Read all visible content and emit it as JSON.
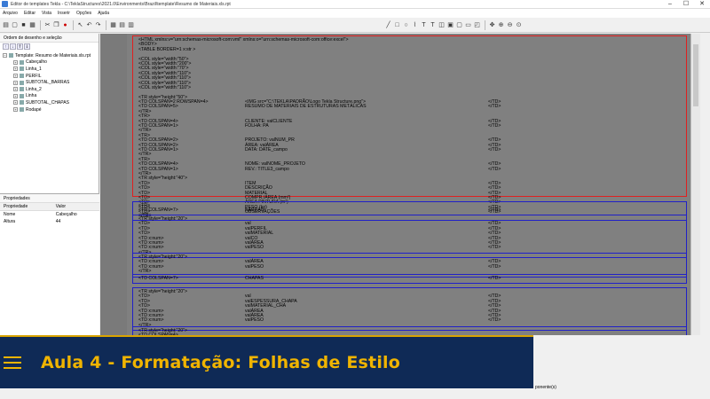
{
  "window": {
    "title": "Editor de templates Tekla - C:\\TeklaStructures\\2021.0\\Environments\\Brazil\\template\\Resumo de Materiais.xls.rpt",
    "minimize": "–",
    "maximize": "☐",
    "close": "✕"
  },
  "menu": [
    "Arquivo",
    "Editar",
    "Vista",
    "Inserir",
    "Opções",
    "Ajuda"
  ],
  "tree_panel": {
    "caption": "Ordem de desenho e seleção",
    "root": "Template: Resumo de Materiais.xls.rpt",
    "items": [
      "Cabeçalho",
      "Linha_1",
      "PERFIL",
      "SUBTOTAL_BARRAS",
      "Linha_2",
      "Linha",
      "SUBTOTAL_CHAPAS",
      "Rodapé"
    ]
  },
  "properties": {
    "caption": "Propriedades",
    "col_property": "Propriedade",
    "col_value": "Valor",
    "rows": [
      {
        "name": "Nome",
        "value": "Cabeçalho"
      },
      {
        "name": "Altura",
        "value": "44"
      }
    ]
  },
  "banner": {
    "title": "Aula 4 - Formatação: Folhas de Estilo"
  },
  "status": {
    "text": "ponente(s)"
  },
  "colors": {
    "header_border": "#e02020",
    "section_border": "#2020c8",
    "banner_bg": "#0f2a56",
    "banner_accent": "#f0b400"
  },
  "sections": [
    {
      "name": "header-section",
      "kind": "red",
      "lines": [
        [
          "<HTML xmlns:v=\"urn:schemas-microsoft-com:vml\" xmlns:o=\"urn:schemas-microsoft-com:office:excel\">",
          "",
          ""
        ],
        [
          "    <BODY>",
          "",
          ""
        ],
        [
          "    <TABLE BORDER=1 x:str >",
          "",
          ""
        ],
        [
          "",
          "",
          ""
        ],
        [
          "        <COL style=\"width:\"50\">",
          "",
          ""
        ],
        [
          "        <COL style=\"width:\"200\">",
          "",
          ""
        ],
        [
          "        <COL style=\"width:\"70\">",
          "",
          ""
        ],
        [
          "        <COL style=\"width:\"110\">",
          "",
          ""
        ],
        [
          "        <COL style=\"width:\"110\">",
          "",
          ""
        ],
        [
          "        <COL style=\"width:\"110\">",
          "",
          ""
        ],
        [
          "        <COL style=\"width:\"110\">",
          "",
          ""
        ],
        [
          "",
          "",
          ""
        ],
        [
          "        <TR style=\"height:\"50\">",
          "",
          ""
        ],
        [
          "            <TD COLSPAN=2 ROWSPAN=4>",
          "<IMG src=\"C:\\TEKLA\\PADRÃO\\Logo Tekla Structure.png\">",
          "</TD>"
        ],
        [
          "            <TD COLSPAN=5>",
          "RESUMO DE MATERIAIS DE ESTRUTURAS METÁLICAS",
          "</TD>"
        ],
        [
          "        </TR>",
          "",
          ""
        ],
        [
          "        <TR>",
          "",
          ""
        ],
        [
          "            <TD COLSPAN=4>",
          "CLIENTE: valCLIENTE",
          "</TD>"
        ],
        [
          "            <TD COLSPAN=1>",
          "FOLHA: PA",
          "</TD>"
        ],
        [
          "        </TR>",
          "",
          ""
        ],
        [
          "        <TR>",
          "",
          ""
        ],
        [
          "            <TD COLSPAN=2>",
          "PROJETO: valNUM_PR",
          "</TD>"
        ],
        [
          "            <TD COLSPAN=2>",
          "ÁREA: valÁREA",
          "</TD>"
        ],
        [
          "            <TD COLSPAN=1>",
          "DATA: DATE_campo",
          "</TD>"
        ],
        [
          "        </TR>",
          "",
          ""
        ],
        [
          "        <TR>",
          "",
          ""
        ],
        [
          "            <TD COLSPAN=4>",
          "NOME: valNOME_PROJETO",
          "</TD>"
        ],
        [
          "            <TD COLSPAN=1>",
          "REV.: TITLE3_campo",
          "</TD>"
        ],
        [
          "        </TR>",
          "",
          ""
        ],
        [
          "        <TR style=\"height:\"40\">",
          "",
          ""
        ],
        [
          "            <TD>",
          "ITEM",
          "</TD>"
        ],
        [
          "            <TD>",
          "DESCRIÇÃO",
          "</TD>"
        ],
        [
          "            <TD>",
          "MATERIAL",
          "</TD>"
        ],
        [
          "            <TD>",
          "COMPR./ÁREA   (mm²)",
          "</TD>"
        ],
        [
          "            <TD>",
          "ÁREA PINTURA   (m²)",
          "</TD>"
        ],
        [
          "            <TD>",
          "PESO  (kg)",
          "</TD>"
        ],
        [
          "            <TD>",
          "OBSERVAÇÕES",
          "</TD>"
        ],
        [
          "        </TR>",
          "",
          ""
        ]
      ]
    },
    {
      "name": "linha-1-section",
      "kind": "blue",
      "lines": [
        [
          "        <TR>",
          "",
          ""
        ],
        [
          "            <TD COLSPAN=7>",
          "BARRAS",
          "</TD>"
        ],
        [
          "        </TR>",
          "",
          ""
        ]
      ]
    },
    {
      "name": "perfil-section",
      "kind": "blue",
      "lines": [
        [
          "        <TR style=\"height:\"20\">",
          "",
          ""
        ],
        [
          "            <TD>",
          "val",
          "</TD>"
        ],
        [
          "            <TD>",
          "valPERFIL",
          "</TD>"
        ],
        [
          "            <TD>",
          "valMATERIAL",
          "</TD>"
        ],
        [
          "            <TD x:num>",
          "valCO",
          "</TD>"
        ],
        [
          "            <TD x:num>",
          "valÁREA",
          "</TD>"
        ],
        [
          "            <TD x:num>",
          "valPESO",
          "</TD>"
        ],
        [
          "        </TR>",
          "",
          ""
        ]
      ]
    },
    {
      "name": "subtotal-barras-section",
      "kind": "blue",
      "lines": [
        [
          "        <TR style=\"height:\"20\">",
          "",
          ""
        ],
        [
          "            <TD x:num>",
          "valÁREA",
          "</TD>"
        ],
        [
          "            <TD x:num>",
          "valPESO",
          "</TD>"
        ],
        [
          "        </TR>",
          "",
          ""
        ]
      ]
    },
    {
      "name": "linha-2-section",
      "kind": "blue",
      "lines": [
        [
          "            <TD COLSPAN=7>",
          "CHAPAS",
          "</TD>"
        ]
      ]
    },
    {
      "name": "linha-section",
      "kind": "blue",
      "lines": [
        [
          "        <TR style=\"height:\"20\">",
          "",
          ""
        ],
        [
          "            <TD>",
          "val",
          "</TD>"
        ],
        [
          "            <TD>",
          "valESPESSURA_CHAPA",
          "</TD>"
        ],
        [
          "            <TD>",
          "valMATERIAL_CHA",
          "</TD>"
        ],
        [
          "            <TD x:num>",
          "valÁREA",
          "</TD>"
        ],
        [
          "            <TD x:num>",
          "valÁREA",
          "</TD>"
        ],
        [
          "            <TD x:num>",
          "valPESO",
          "</TD>"
        ],
        [
          "        </TR>",
          "",
          ""
        ]
      ]
    },
    {
      "name": "subtotal-chapas-section",
      "kind": "blue",
      "lines": [
        [
          "        <TR style=\"height:\"20\">",
          "",
          ""
        ],
        [
          "            <TD COLSPAN=4>",
          "",
          ""
        ]
      ]
    }
  ]
}
